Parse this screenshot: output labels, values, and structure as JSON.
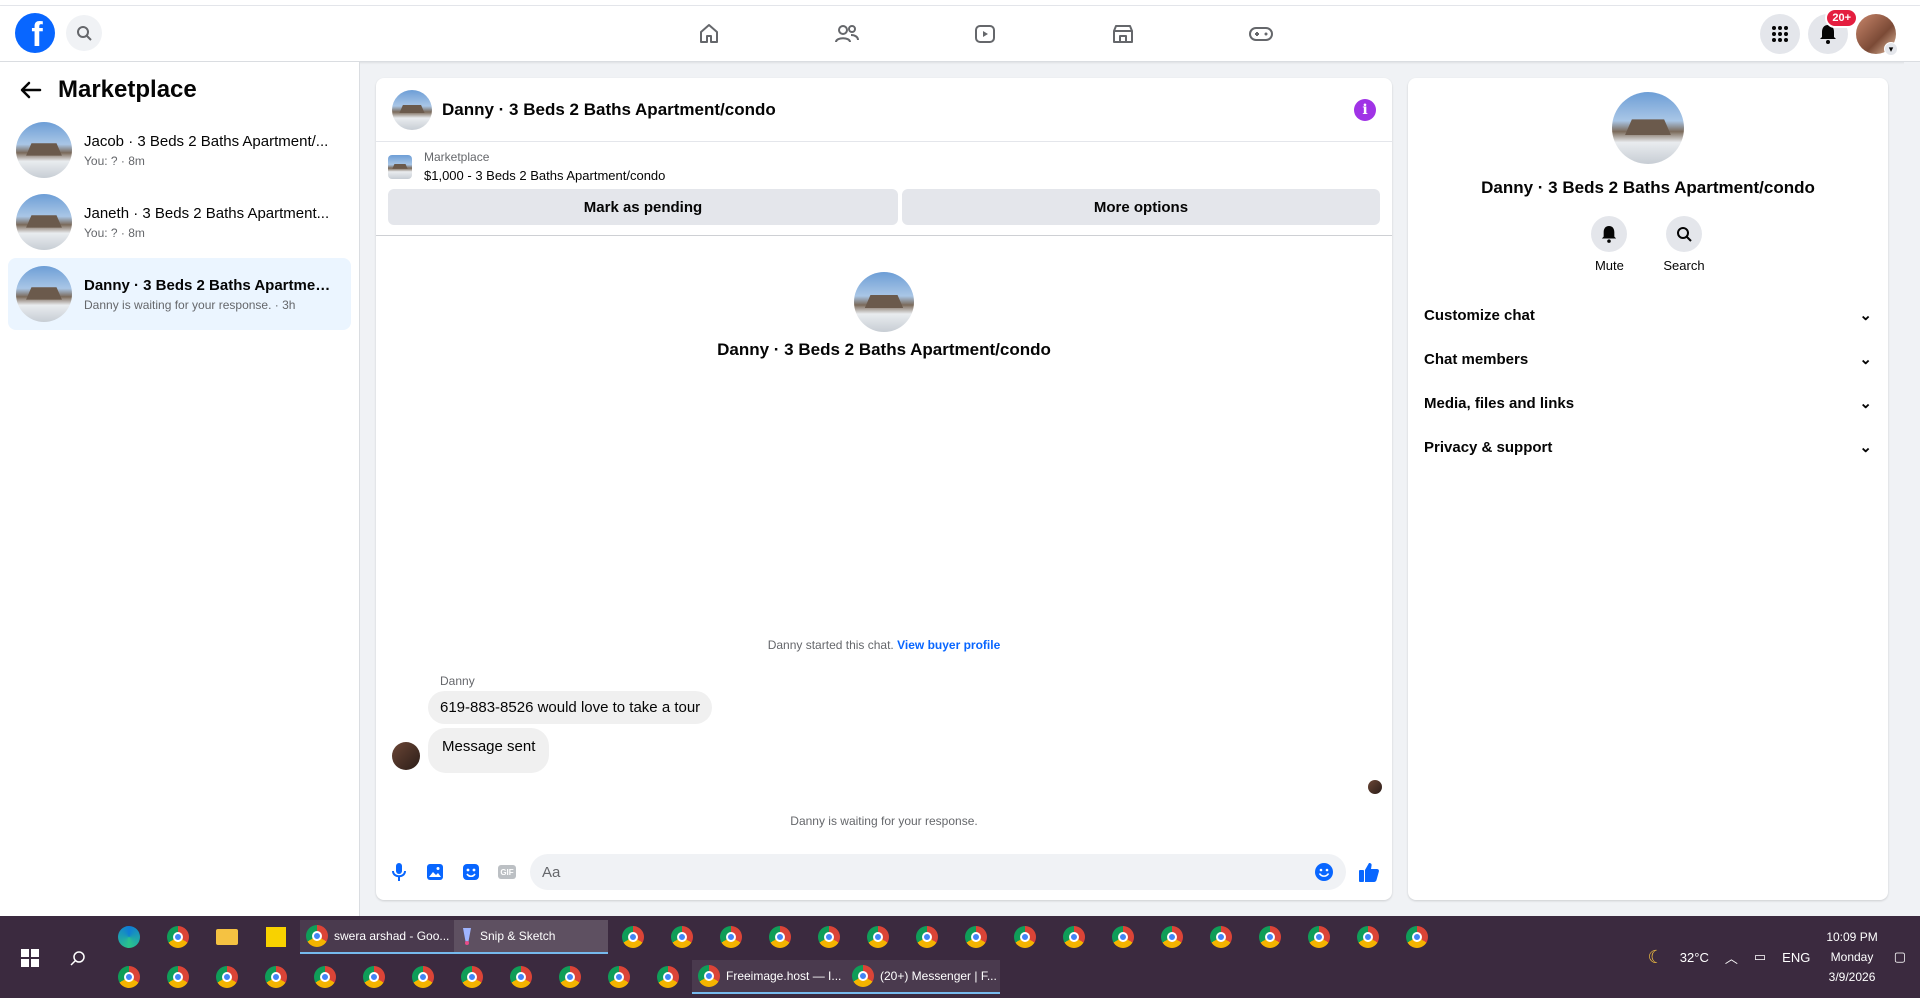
{
  "topbar": {
    "logo": "f",
    "nav": [
      "home-icon",
      "friends-icon",
      "video-icon",
      "marketplace-icon",
      "gaming-icon"
    ],
    "notif_badge": "20+"
  },
  "sidebar": {
    "title": "Marketplace",
    "conversations": [
      {
        "title": "Jacob · 3 Beds 2 Baths Apartment/...",
        "sub": "You: ? · 8m"
      },
      {
        "title": "Janeth · 3 Beds 2 Baths Apartment...",
        "sub": "You: ? · 8m"
      },
      {
        "title": "Danny · 3 Beds 2 Baths Apartment...",
        "sub": "Danny is waiting for your response. · 3h"
      }
    ]
  },
  "chat": {
    "header_title": "Danny · 3 Beds 2 Baths Apartment/condo",
    "listing_source": "Marketplace",
    "listing_title": "$1,000 - 3 Beds 2 Baths Apartment/condo",
    "btn_pending": "Mark as pending",
    "btn_more": "More options",
    "profile_name": "Danny · 3 Beds 2 Baths Apartment/condo",
    "started_text": "Danny started this chat.",
    "buyer_link": "View buyer profile",
    "sender": "Danny",
    "message_in": "619-883-8526 would love to take a tour",
    "message_out": "Message sent",
    "waiting": "Danny is waiting for your response.",
    "input_placeholder": "Aa",
    "gif": "GIF"
  },
  "rpanel": {
    "name": "Danny · 3 Beds 2 Baths Apartment/condo",
    "mute": "Mute",
    "search": "Search",
    "sections": [
      "Customize chat",
      "Chat members",
      "Media, files and links",
      "Privacy & support"
    ]
  },
  "taskbar": {
    "item_swera": "swera arshad - Goo...",
    "item_snip": "Snip & Sketch",
    "item_freeimage": "Freeimage.host — I...",
    "item_messenger": "(20+) Messenger | F...",
    "weather": "32°C",
    "lang": "ENG",
    "time": "10:09 PM",
    "day": "Monday",
    "date": "3/9/2026"
  }
}
